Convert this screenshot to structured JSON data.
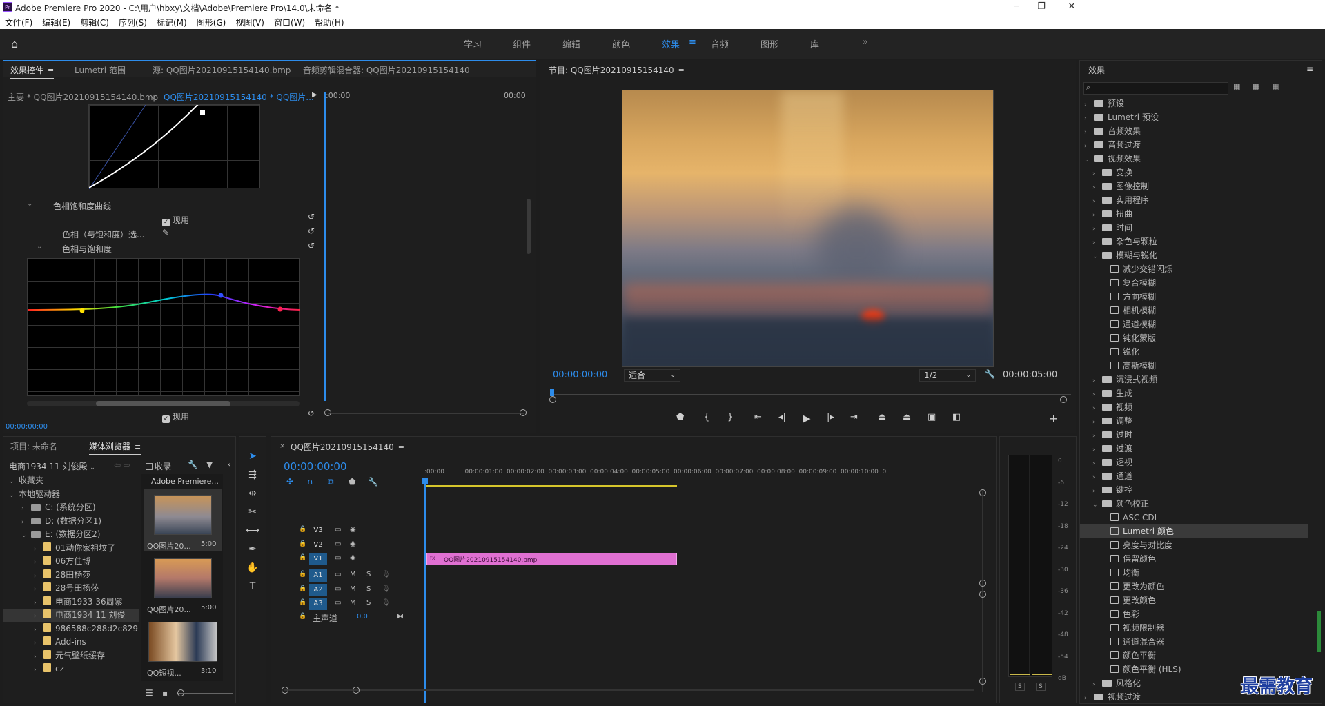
{
  "titlebar": {
    "logo": "Pr",
    "title": "Adobe Premiere Pro 2020 - C:\\用户\\hbxy\\文档\\Adobe\\Premiere Pro\\14.0\\未命名 *",
    "min": "─",
    "max": "❐",
    "close": "✕"
  },
  "menu": [
    "文件(F)",
    "编辑(E)",
    "剪辑(C)",
    "序列(S)",
    "标记(M)",
    "图形(G)",
    "视图(V)",
    "窗口(W)",
    "帮助(H)"
  ],
  "workspaces": {
    "items": [
      "学习",
      "组件",
      "编辑",
      "颜色",
      "效果",
      "音频",
      "图形",
      "库"
    ],
    "active": "效果",
    "more": "»"
  },
  "effect_controls": {
    "tabs": [
      "效果控件",
      "Lumetri 范围",
      "源: QQ图片20210915154140.bmp",
      "音频剪辑混合器: QQ图片20210915154140"
    ],
    "master": "主要 * QQ图片20210915154140.bmp",
    "sequence_clip": "QQ图片20210915154140 * QQ图片...",
    "time_start": ":00:00",
    "time_end": "00:00",
    "section_title": "色相饱和度曲线",
    "enable_label": "现用",
    "hue_select_label": "色相（与饱和度）选...",
    "hue_sat_label": "色相与饱和度",
    "bottom_enable_label": "现用",
    "timecode": "00:00:00:00"
  },
  "program_monitor": {
    "title": "节目: QQ图片20210915154140",
    "timecode": "00:00:00:00",
    "fit": "适合",
    "resolution": "1/2",
    "duration": "00:00:05:00"
  },
  "effects_panel": {
    "title": "效果",
    "search_placeholder": "",
    "items": [
      {
        "label": "预设",
        "level": 0,
        "type": "folder",
        "open": false
      },
      {
        "label": "Lumetri 预设",
        "level": 0,
        "type": "folder",
        "open": false
      },
      {
        "label": "音频效果",
        "level": 0,
        "type": "folder",
        "open": false
      },
      {
        "label": "音频过渡",
        "level": 0,
        "type": "folder",
        "open": false
      },
      {
        "label": "视频效果",
        "level": 0,
        "type": "folder",
        "open": true
      },
      {
        "label": "变换",
        "level": 1,
        "type": "folder",
        "open": false
      },
      {
        "label": "图像控制",
        "level": 1,
        "type": "folder",
        "open": false
      },
      {
        "label": "实用程序",
        "level": 1,
        "type": "folder",
        "open": false
      },
      {
        "label": "扭曲",
        "level": 1,
        "type": "folder",
        "open": false
      },
      {
        "label": "时间",
        "level": 1,
        "type": "folder",
        "open": false
      },
      {
        "label": "杂色与颗粒",
        "level": 1,
        "type": "folder",
        "open": false
      },
      {
        "label": "模糊与锐化",
        "level": 1,
        "type": "folder",
        "open": true
      },
      {
        "label": "减少交错闪烁",
        "level": 2,
        "type": "effect"
      },
      {
        "label": "复合模糊",
        "level": 2,
        "type": "effect"
      },
      {
        "label": "方向模糊",
        "level": 2,
        "type": "effect"
      },
      {
        "label": "相机模糊",
        "level": 2,
        "type": "effect"
      },
      {
        "label": "通道模糊",
        "level": 2,
        "type": "effect"
      },
      {
        "label": "钝化蒙版",
        "level": 2,
        "type": "effect"
      },
      {
        "label": "锐化",
        "level": 2,
        "type": "effect"
      },
      {
        "label": "高斯模糊",
        "level": 2,
        "type": "effect"
      },
      {
        "label": "沉浸式视频",
        "level": 1,
        "type": "folder",
        "open": false
      },
      {
        "label": "生成",
        "level": 1,
        "type": "folder",
        "open": false
      },
      {
        "label": "视频",
        "level": 1,
        "type": "folder",
        "open": false
      },
      {
        "label": "调整",
        "level": 1,
        "type": "folder",
        "open": false
      },
      {
        "label": "过时",
        "level": 1,
        "type": "folder",
        "open": false
      },
      {
        "label": "过渡",
        "level": 1,
        "type": "folder",
        "open": false
      },
      {
        "label": "透视",
        "level": 1,
        "type": "folder",
        "open": false
      },
      {
        "label": "通道",
        "level": 1,
        "type": "folder",
        "open": false
      },
      {
        "label": "键控",
        "level": 1,
        "type": "folder",
        "open": false
      },
      {
        "label": "颜色校正",
        "level": 1,
        "type": "folder",
        "open": true
      },
      {
        "label": "ASC CDL",
        "level": 2,
        "type": "effect"
      },
      {
        "label": "Lumetri 颜色",
        "level": 2,
        "type": "effect",
        "selected": true
      },
      {
        "label": "亮度与对比度",
        "level": 2,
        "type": "effect"
      },
      {
        "label": "保留颜色",
        "level": 2,
        "type": "effect"
      },
      {
        "label": "均衡",
        "level": 2,
        "type": "effect"
      },
      {
        "label": "更改为颜色",
        "level": 2,
        "type": "effect"
      },
      {
        "label": "更改颜色",
        "level": 2,
        "type": "effect"
      },
      {
        "label": "色彩",
        "level": 2,
        "type": "effect"
      },
      {
        "label": "视频限制器",
        "level": 2,
        "type": "effect"
      },
      {
        "label": "通道混合器",
        "level": 2,
        "type": "effect"
      },
      {
        "label": "颜色平衡",
        "level": 2,
        "type": "effect"
      },
      {
        "label": "颜色平衡 (HLS)",
        "level": 2,
        "type": "effect"
      },
      {
        "label": "风格化",
        "level": 1,
        "type": "folder",
        "open": false
      },
      {
        "label": "视频过渡",
        "level": 0,
        "type": "folder",
        "open": false
      }
    ]
  },
  "project_panel": {
    "tabs": [
      "项目: 未命名",
      "媒体浏览器"
    ],
    "location": "电商1934 11 刘俊殿",
    "favorites_label": "收录",
    "tree": [
      {
        "label": "收藏夹",
        "level": 0
      },
      {
        "label": "本地驱动器",
        "level": 0
      },
      {
        "label": "C: (系统分区)",
        "level": 1
      },
      {
        "label": "D: (数据分区1)",
        "level": 1
      },
      {
        "label": "E: (数据分区2)",
        "level": 1
      },
      {
        "label": "01动你家祖坟了",
        "level": 2
      },
      {
        "label": "06方佳博",
        "level": 2
      },
      {
        "label": "28田杨莎",
        "level": 2
      },
      {
        "label": "28号田杨莎",
        "level": 2
      },
      {
        "label": "电商1933 36周紫",
        "level": 2
      },
      {
        "label": "电商1934 11 刘俊",
        "level": 2
      },
      {
        "label": "986588c288d2c829",
        "level": 2
      },
      {
        "label": "Add-ins",
        "level": 2
      },
      {
        "label": "元气壁纸缓存",
        "level": 2
      },
      {
        "label": "cz",
        "level": 2
      }
    ],
    "thumb_header": "Adobe Premiere...",
    "thumbs": [
      {
        "name": "QQ图片20...",
        "dur": "5:00"
      },
      {
        "name": "QQ图片20...",
        "dur": "5:00"
      },
      {
        "name": "QQ短视...",
        "dur": "3:10"
      }
    ]
  },
  "timeline": {
    "sequence_name": "QQ图片20210915154140",
    "timecode": "00:00:00:00",
    "ruler": [
      ":00:00",
      "00:00:01:00",
      "00:00:02:00",
      "00:00:03:00",
      "00:00:04:00",
      "00:00:05:00",
      "00:00:06:00",
      "00:00:07:00",
      "00:00:08:00",
      "00:00:09:00",
      "00:00:10:00",
      "0"
    ],
    "video_tracks": [
      "V3",
      "V2",
      "V1"
    ],
    "audio_tracks": [
      "A1",
      "A2",
      "A3"
    ],
    "master_label": "主声道",
    "master_value": "0.0",
    "mute": "M",
    "solo": "S",
    "clip_label": "QQ图片20210915154140.bmp",
    "clip_fx": "fx"
  },
  "audio_meter": {
    "labels": [
      "0",
      "-6",
      "-12",
      "-18",
      "-24",
      "-30",
      "-36",
      "-42",
      "-48",
      "-54",
      "dB"
    ],
    "solo_left": "S",
    "solo_right": "S"
  },
  "watermark": "最需教育",
  "colors": {
    "accent": "#2d8ceb",
    "clip": "#e070d2",
    "panel": "#1e1e1e",
    "active_border": "#2d8ceb"
  }
}
